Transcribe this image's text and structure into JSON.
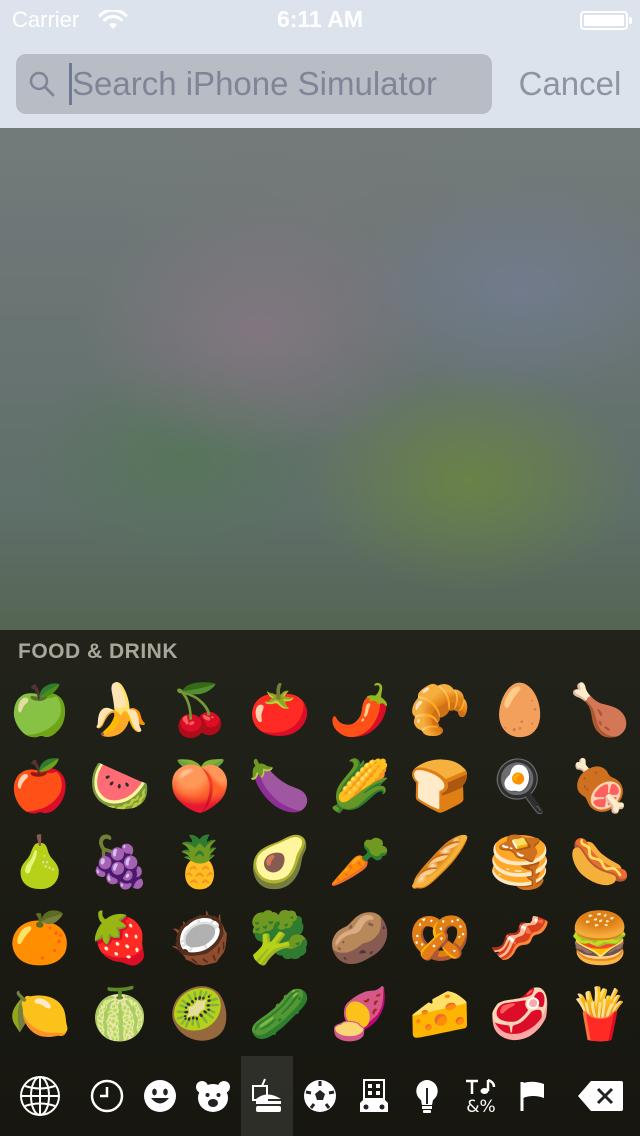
{
  "status": {
    "carrier": "Carrier",
    "time": "6:11 AM"
  },
  "search": {
    "placeholder": "Search iPhone Simulator",
    "value": ""
  },
  "cancel_label": "Cancel",
  "keyboard": {
    "category_title": "FOOD & DRINK",
    "emoji": [
      "🍏",
      "🍌",
      "🍒",
      "🍅",
      "🌶️",
      "🥐",
      "🥚",
      "🍗",
      "🍎",
      "🍉",
      "🍑",
      "🍆",
      "🌽",
      "🍞",
      "🍳",
      "🍖",
      "🍐",
      "🍇",
      "🍍",
      "🥑",
      "🥕",
      "🥖",
      "🥞",
      "🌭",
      "🍊",
      "🍓",
      "🥥",
      "🥦",
      "🥔",
      "🥨",
      "🥓",
      "🍔",
      "🍋",
      "🍈",
      "🥝",
      "🥒",
      "🍠",
      "🧀",
      "🥩",
      "🍟"
    ],
    "bottom_tabs": [
      {
        "name": "globe-icon"
      },
      {
        "name": "recent-clock-icon"
      },
      {
        "name": "smiley-icon"
      },
      {
        "name": "bear-icon"
      },
      {
        "name": "food-drink-icon",
        "selected": true
      },
      {
        "name": "soccer-ball-icon"
      },
      {
        "name": "travel-building-icon"
      },
      {
        "name": "lightbulb-icon"
      },
      {
        "name": "symbols-icon",
        "text": "&%"
      },
      {
        "name": "flag-icon"
      },
      {
        "name": "delete-icon"
      }
    ]
  },
  "colors": {
    "top_bar": "#dde3ec",
    "search_field": "#b8bcc5",
    "keyboard_bg": "#1c1b14",
    "category_title": "#a8a79a",
    "cancel": "#8e95a0"
  }
}
